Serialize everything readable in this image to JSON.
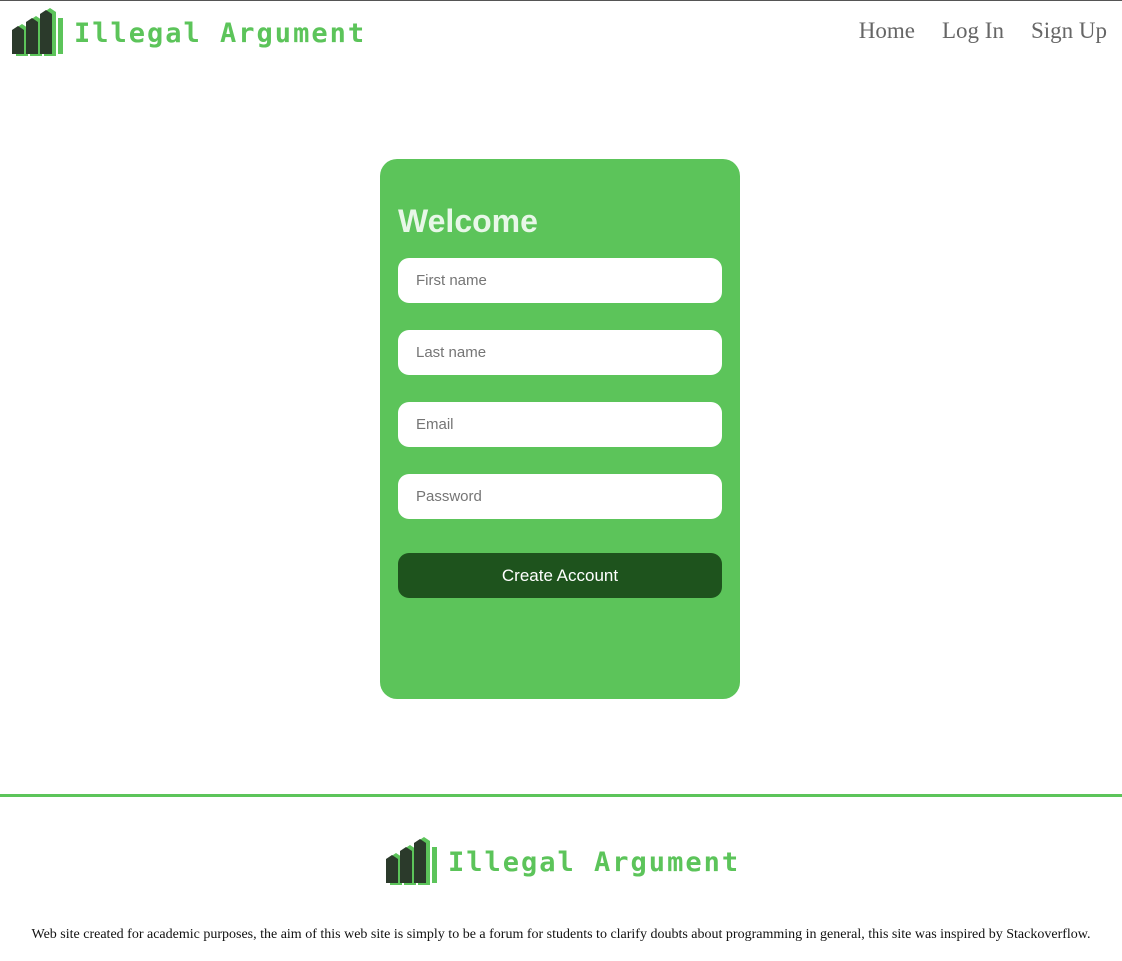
{
  "brand": {
    "name": "Illegal Argument",
    "color": "#5cc45a",
    "dark": "#2b3a2b"
  },
  "nav": {
    "items": [
      {
        "label": "Home"
      },
      {
        "label": "Log In"
      },
      {
        "label": "Sign Up"
      }
    ]
  },
  "signup": {
    "title": "Welcome",
    "first_name": {
      "placeholder": "First name",
      "value": ""
    },
    "last_name": {
      "placeholder": "Last name",
      "value": ""
    },
    "email": {
      "placeholder": "Email",
      "value": ""
    },
    "password": {
      "placeholder": "Password",
      "value": ""
    },
    "submit_label": "Create Account",
    "card_color": "#5cc45a",
    "button_color": "#1e531d"
  },
  "footer": {
    "brand_name": "Illegal Argument",
    "text": "Web site created for academic purposes, the aim of this web site is simply to be a forum for students to clarify doubts about programming in general, this site was inspired by Stackoverflow."
  },
  "icons": {
    "logo": "stacked-bars-logo-icon"
  }
}
